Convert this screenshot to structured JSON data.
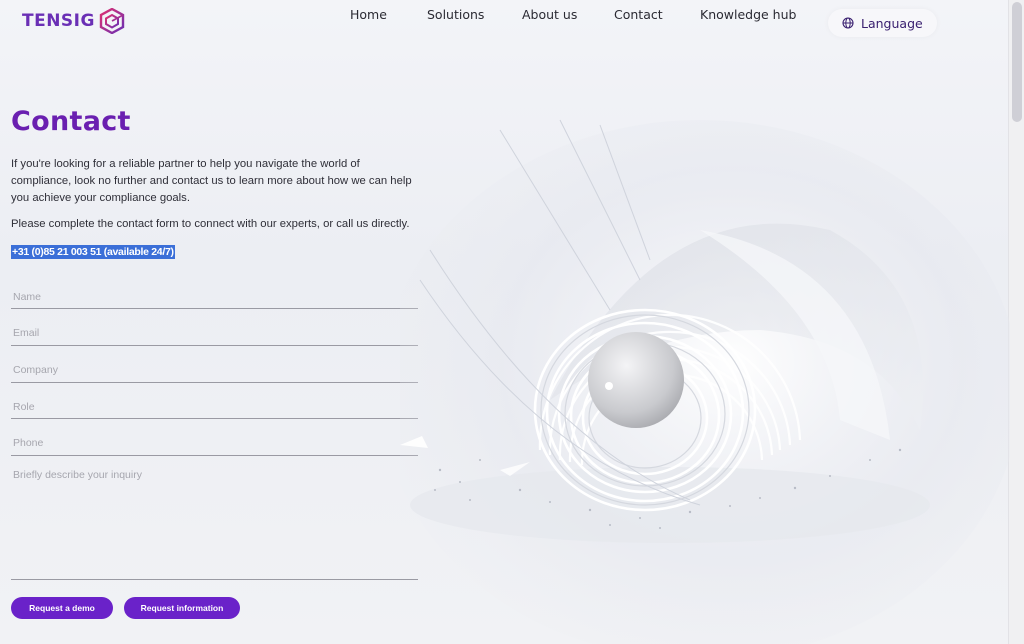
{
  "header": {
    "logo_text": "TENSIG",
    "nav": [
      {
        "label": "Home"
      },
      {
        "label": "Solutions"
      },
      {
        "label": "About us"
      },
      {
        "label": "Contact"
      },
      {
        "label": "Knowledge hub"
      }
    ],
    "language_label": "Language"
  },
  "main": {
    "title": "Contact",
    "intro": "If you're looking for a reliable partner to help you navigate the world of compliance, look no further and contact us to learn more about how we can help you achieve your compliance goals.",
    "intro2": "Please complete the contact form to connect with our experts, or call us directly.",
    "phone": "+31 (0)85 21 003 51 (available 24/7)"
  },
  "form": {
    "name_placeholder": "Name",
    "email_placeholder": "Email",
    "company_placeholder": "Company",
    "role_placeholder": "Role",
    "phone_placeholder": "Phone",
    "inquiry_placeholder": "Briefly describe your inquiry",
    "demo_button": "Request a demo",
    "info_button": "Request information"
  },
  "colors": {
    "brand_purple": "#6a1fb0",
    "button_purple": "#6a22c9",
    "selection_blue": "#3b6fd8"
  }
}
